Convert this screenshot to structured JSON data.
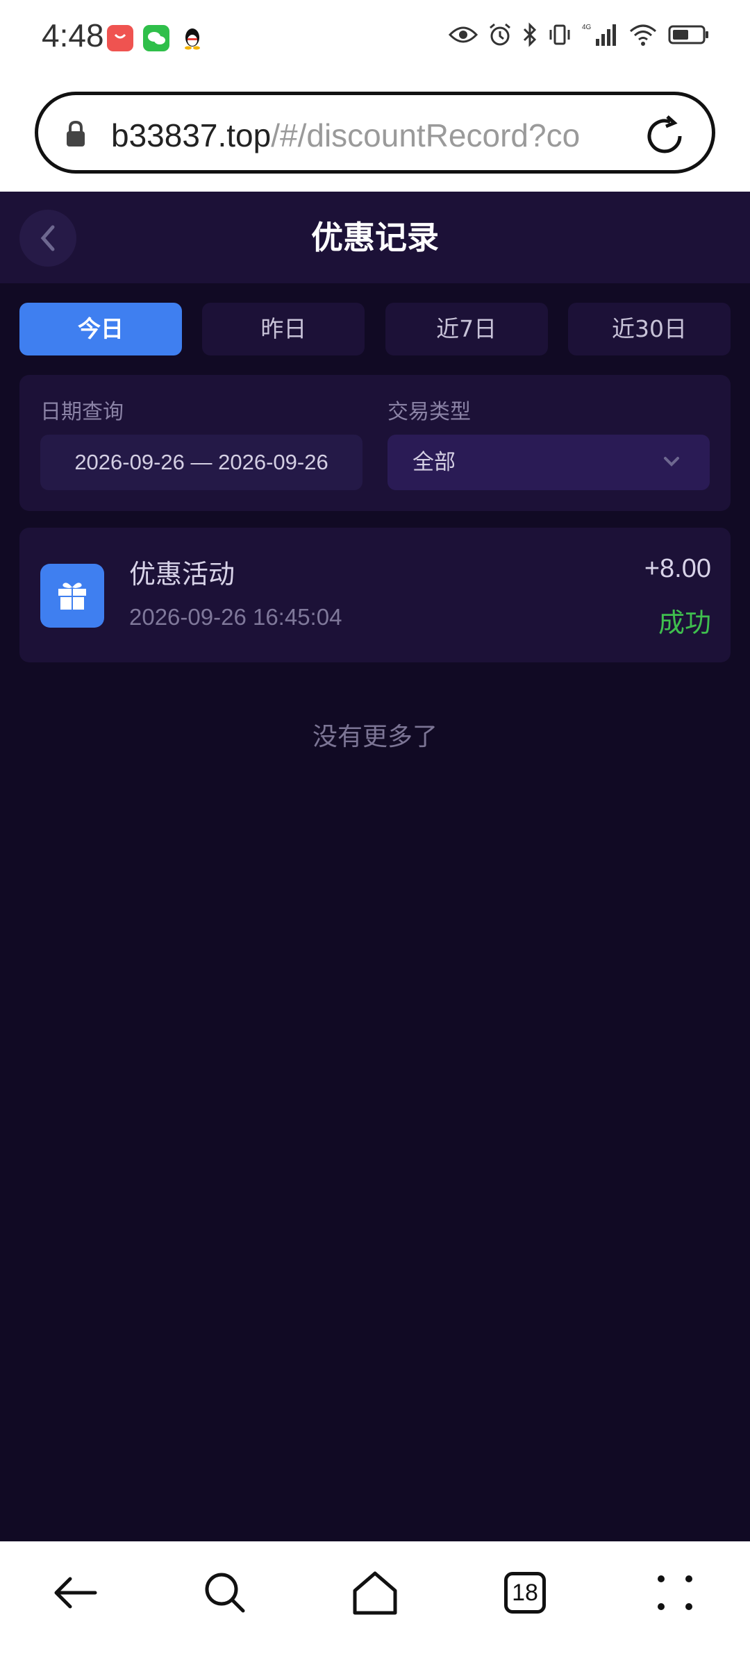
{
  "status_bar": {
    "time": "4:48",
    "apps": [
      "shopping-app-icon",
      "wechat-icon",
      "qq-icon"
    ],
    "network": "4G"
  },
  "browser": {
    "url_host": "b33837.top",
    "url_path": "/#/discountRecord?co",
    "tab_count": "18"
  },
  "header": {
    "title": "优惠记录"
  },
  "tabs": [
    {
      "label": "今日",
      "active": true
    },
    {
      "label": "昨日",
      "active": false
    },
    {
      "label": "近7日",
      "active": false
    },
    {
      "label": "近30日",
      "active": false
    }
  ],
  "filters": {
    "date_label": "日期查询",
    "date_range": "2026-09-26 — 2026-09-26",
    "type_label": "交易类型",
    "type_value": "全部"
  },
  "records": [
    {
      "title": "优惠活动",
      "time": "2026-09-26 16:45:04",
      "amount": "+8.00",
      "status": "成功"
    }
  ],
  "list_footer": "没有更多了",
  "colors": {
    "accent": "#3f7ff0",
    "background": "#110a24",
    "card": "#1c1137",
    "success": "#3fbf4e"
  }
}
